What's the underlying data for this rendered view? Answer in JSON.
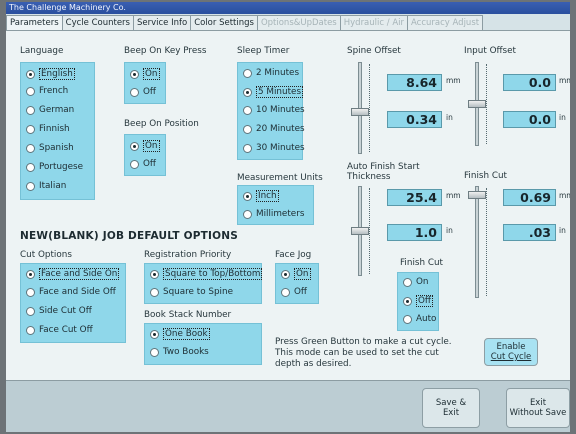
{
  "window": {
    "title": "The Challenge Machinery Co."
  },
  "tabs": [
    {
      "label": "Parameters",
      "state": "active"
    },
    {
      "label": "Cycle Counters",
      "state": "normal"
    },
    {
      "label": "Service Info",
      "state": "normal"
    },
    {
      "label": "Color Settings",
      "state": "normal"
    },
    {
      "label": "Options&UpDates",
      "state": "disabled"
    },
    {
      "label": "Hydraulic / Air",
      "state": "disabled"
    },
    {
      "label": "Accuracy Adjust",
      "state": "disabled"
    }
  ],
  "language": {
    "title": "Language",
    "options": [
      "English",
      "French",
      "German",
      "Finnish",
      "Spanish",
      "Portugese",
      "Italian"
    ],
    "selected": "English"
  },
  "beep_keypress": {
    "title": "Beep On Key Press",
    "options": [
      "On",
      "Off"
    ],
    "selected": "On"
  },
  "beep_position": {
    "title": "Beep On Position",
    "options": [
      "On",
      "Off"
    ],
    "selected": "On"
  },
  "sleep_timer": {
    "title": "Sleep Timer",
    "options": [
      "2 Minutes",
      "5 Minutes",
      "10 Minutes",
      "20 Minutes",
      "30 Minutes"
    ],
    "selected": "5 Minutes"
  },
  "measurement_units": {
    "title": "Measurement Units",
    "options": [
      "Inch",
      "Millimeters"
    ],
    "selected": "Inch"
  },
  "spine_offset": {
    "title": "Spine Offset",
    "mm_value": "8.64",
    "in_value": "0.34",
    "mm_unit": "mm",
    "in_unit": "in"
  },
  "input_offset": {
    "title": "Input Offset",
    "mm_value": "0.0",
    "in_value": "0.0",
    "mm_unit": "mm",
    "in_unit": "in"
  },
  "auto_finish": {
    "title": "Auto Finish Start Thickness",
    "mm_value": "25.4",
    "in_value": "1.0",
    "mm_unit": "mm",
    "in_unit": "in"
  },
  "finish_cut_value": {
    "title": "Finish Cut",
    "mm_value": "0.69",
    "in_value": ".03",
    "mm_unit": "mm",
    "in_unit": "in"
  },
  "finish_cut_mode": {
    "title": "Finish Cut",
    "options": [
      "On",
      "Off",
      "Auto"
    ],
    "selected": "Off"
  },
  "job_defaults": {
    "title": "NEW(BLANK) JOB DEFAULT OPTIONS"
  },
  "cut_options": {
    "title": "Cut Options",
    "options": [
      "Face and Side On",
      "Face and Side Off",
      "Side Cut Off",
      "Face Cut Off"
    ],
    "selected": "Face and Side On"
  },
  "registration_priority": {
    "title": "Registration Priority",
    "options": [
      "Square to Top/Bottom",
      "Square to Spine"
    ],
    "selected": "Square to Top/Bottom"
  },
  "face_jog": {
    "title": "Face Jog",
    "options": [
      "On",
      "Off"
    ],
    "selected": "On"
  },
  "book_stack": {
    "title": "Book Stack Number",
    "options": [
      "One Book",
      "Two Books"
    ],
    "selected": "One Book"
  },
  "help_text": [
    "Press Green Button to make a cut cycle.",
    "This mode can be used to set the cut",
    "depth as desired."
  ],
  "enable_cut": {
    "line1": "Enable",
    "line2": "Cut Cycle"
  },
  "footer": {
    "save_line1": "Save &",
    "save_line2": "Exit",
    "exit_line1": "Exit",
    "exit_line2": "Without Save"
  },
  "sliders": {
    "spine_offset": 0.45,
    "input_offset": 0.5,
    "auto_finish": 0.5,
    "finish_cut": 0.95
  }
}
